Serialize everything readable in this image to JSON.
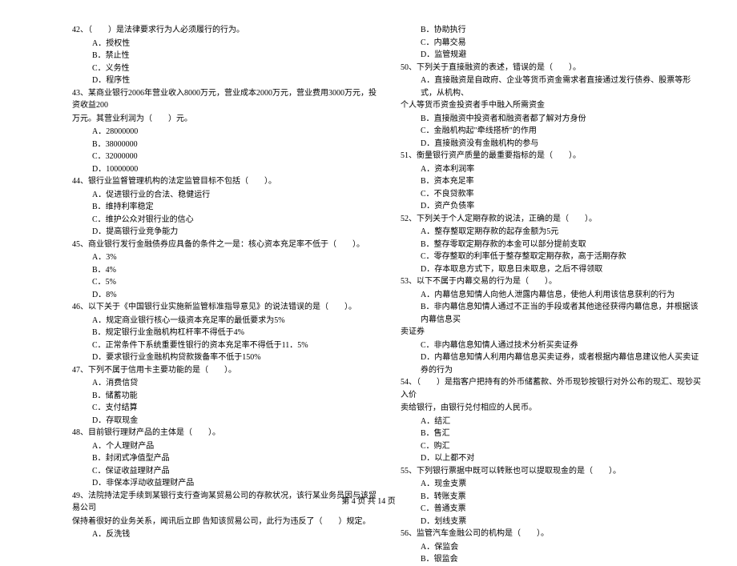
{
  "footer": "第 4 页 共 14 页",
  "left": [
    {
      "t": "q",
      "v": "42、（　　）是法律要求行为人必须履行的行为。"
    },
    {
      "t": "o",
      "v": "A．授权性"
    },
    {
      "t": "o",
      "v": "B．禁止性"
    },
    {
      "t": "o",
      "v": "C．义务性"
    },
    {
      "t": "o",
      "v": "D．程序性"
    },
    {
      "t": "q",
      "v": "43、某商业银行2006年营业收入8000万元，营业成本2000万元，营业费用3000万元，投资收益200"
    },
    {
      "t": "q",
      "v": "万元。其营业利润为（　　）元。"
    },
    {
      "t": "o",
      "v": "A．28000000"
    },
    {
      "t": "o",
      "v": "B．38000000"
    },
    {
      "t": "o",
      "v": "C．32000000"
    },
    {
      "t": "o",
      "v": "D．10000000"
    },
    {
      "t": "q",
      "v": "44、银行业监督管理机构的法定监管目标不包括（　　）。"
    },
    {
      "t": "o",
      "v": "A．促进银行业的合法、稳健运行"
    },
    {
      "t": "o",
      "v": "B．维持利率稳定"
    },
    {
      "t": "o",
      "v": "C．维护公众对银行业的信心"
    },
    {
      "t": "o",
      "v": "D．提高银行业竞争能力"
    },
    {
      "t": "q",
      "v": "45、商业银行发行金融债券应具备的条件之一是：核心资本充足率不低于（　　）。"
    },
    {
      "t": "o",
      "v": "A．3%"
    },
    {
      "t": "o",
      "v": "B．4%"
    },
    {
      "t": "o",
      "v": "C．5%"
    },
    {
      "t": "o",
      "v": "D．8%"
    },
    {
      "t": "q",
      "v": "46、以下关于《中国银行业实施新监管标准指导意见》的说法错误的是（　　）。"
    },
    {
      "t": "o",
      "v": "A．规定商业银行核心一级资本充足率的最低要求为5%"
    },
    {
      "t": "o",
      "v": "B．规定银行业金融机构杠杆率不得低于4%"
    },
    {
      "t": "o",
      "v": "C．正常条件下系统重要性银行的资本充足率不得低于11．5%"
    },
    {
      "t": "o",
      "v": "D．要求银行业金融机构贷款拨备率不低于150%"
    },
    {
      "t": "q",
      "v": "47、下列不属于信用卡主要功能的是（　　）。"
    },
    {
      "t": "o",
      "v": "A．消费信贷"
    },
    {
      "t": "o",
      "v": "B．储蓄功能"
    },
    {
      "t": "o",
      "v": "C．支付结算"
    },
    {
      "t": "o",
      "v": "D．存取现金"
    },
    {
      "t": "q",
      "v": "48、目前银行理财产品的主体是（　　）。"
    },
    {
      "t": "o",
      "v": "A．个人理财产品"
    },
    {
      "t": "o",
      "v": "B．封闭式净值型产品"
    },
    {
      "t": "o",
      "v": "C．保证收益理财产品"
    },
    {
      "t": "o",
      "v": "D．非保本浮动收益理财产品"
    },
    {
      "t": "q",
      "v": "49、法院持法定手续到某银行支行查询某贸易公司的存款状况，该行某业务员因与该贸易公司"
    },
    {
      "t": "q",
      "v": "保持着很好的业务关系，闻讯后立即 告知该贸易公司，此行为违反了（　　）规定。"
    },
    {
      "t": "o",
      "v": "A．反洗钱"
    }
  ],
  "right": [
    {
      "t": "o",
      "v": "B．协助执行"
    },
    {
      "t": "o",
      "v": "C．内幕交易"
    },
    {
      "t": "o",
      "v": "D．监管规避"
    },
    {
      "t": "q",
      "v": "50、下列关于直接融资的表述，错误的是（　　）。"
    },
    {
      "t": "o",
      "v": "A．直接融资是自政府、企业等货币资金需求者直接通过发行债券、股票等形式，从机构、"
    },
    {
      "t": "q",
      "v": "个人等货币资金投资者手中融入所需资金"
    },
    {
      "t": "o",
      "v": "B．直接融资中投资者和融资者都了解对方身份"
    },
    {
      "t": "o",
      "v": "C．金融机构起\"牵线搭桥\"的作用"
    },
    {
      "t": "o",
      "v": "D．直接融资没有金融机构的参与"
    },
    {
      "t": "q",
      "v": "51、衡量银行资产质量的最重要指标的是（　　）。"
    },
    {
      "t": "o",
      "v": "A．资本利润率"
    },
    {
      "t": "o",
      "v": "B．资本充足率"
    },
    {
      "t": "o",
      "v": "C．不良贷款率"
    },
    {
      "t": "o",
      "v": "D．资产负债率"
    },
    {
      "t": "q",
      "v": "52、下列关于个人定期存款的说法，正确的是（　　）。"
    },
    {
      "t": "o",
      "v": "A．整存整取定期存款的起存金额为5元"
    },
    {
      "t": "o",
      "v": "B．整存零取定期存款的本金可以部分提前支取"
    },
    {
      "t": "o",
      "v": "C．零存整取的利率低于整存整取定期存款，高于活期存款"
    },
    {
      "t": "o",
      "v": "D．存本取息方式下，取息日未取息，之后不得领取"
    },
    {
      "t": "q",
      "v": "53、以下不属于内幕交易的行为是（　　）。"
    },
    {
      "t": "o",
      "v": "A．内幕信息知情人向他人泄露内幕信息，使他人利用该信息获利的行为"
    },
    {
      "t": "o",
      "v": "B．非内幕信息知情人通过不正当的手段或者其他途径获得内幕信息，并根据该内幕信息买"
    },
    {
      "t": "q",
      "v": "卖证券"
    },
    {
      "t": "o",
      "v": "C．非内幕信息知情人通过技术分析买卖证券"
    },
    {
      "t": "o",
      "v": "D．内幕信息知情人利用内幕信息买卖证券，或者根据内幕信息建议他人买卖证券的行为"
    },
    {
      "t": "q",
      "v": "54、（　　）是指客户把持有的外币储蓄款、外币现钞按银行对外公布的现汇、现钞买入价"
    },
    {
      "t": "q",
      "v": "卖给银行，由银行兑付相应的人民币。"
    },
    {
      "t": "o",
      "v": "A．结汇"
    },
    {
      "t": "o",
      "v": "B．售汇"
    },
    {
      "t": "o",
      "v": "C．购汇"
    },
    {
      "t": "o",
      "v": "D．以上都不对"
    },
    {
      "t": "q",
      "v": "55、下列银行票据中既可以转账也可以提取现金的是（　　）。"
    },
    {
      "t": "o",
      "v": "A．现金支票"
    },
    {
      "t": "o",
      "v": "B．转账支票"
    },
    {
      "t": "o",
      "v": "C．普通支票"
    },
    {
      "t": "o",
      "v": "D．划线支票"
    },
    {
      "t": "q",
      "v": "56、监管汽车金融公司的机构是（　　）。"
    },
    {
      "t": "o",
      "v": "A．保监会"
    },
    {
      "t": "o",
      "v": "B．银监会"
    }
  ]
}
